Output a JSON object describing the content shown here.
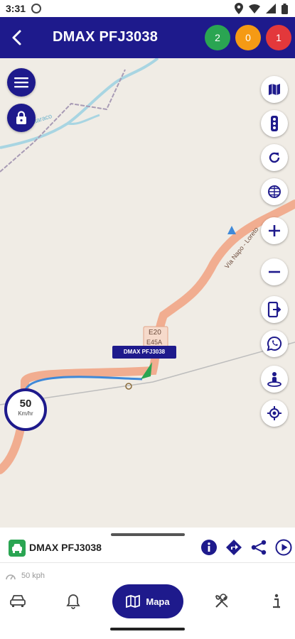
{
  "status_bar": {
    "time": "3:31"
  },
  "header": {
    "title": "DMAX PFJ3038"
  },
  "badges": {
    "green": "2",
    "orange": "0",
    "red": "1"
  },
  "colors": {
    "primary": "#1e1a8c",
    "badge_green": "#2aa552",
    "badge_orange": "#f59a14",
    "badge_red": "#e3383b",
    "route_blue": "#3f89d8",
    "road_highway": "#f1ad90",
    "map_background": "#f0ece5"
  },
  "map": {
    "vehicle_label": "DMAX PFJ3038",
    "road_labels": {
      "river": "Río Huataraco",
      "via": "Vía Napo - Loreto",
      "side_road": "",
      "route_code_1": "E20",
      "route_code_2": "E45A"
    },
    "speed_gauge": {
      "value": "50",
      "unit": "Km/hr"
    },
    "left_buttons": [
      "menu-icon",
      "lock-icon"
    ],
    "right_buttons": [
      "map-layers-icon",
      "traffic-light-icon",
      "refresh-icon",
      "globe-grid-icon",
      "zoom-in-icon",
      "zoom-out-icon",
      "share-screen-icon",
      "whatsapp-icon",
      "street-view-icon",
      "my-location-icon"
    ]
  },
  "bottom_sheet": {
    "vehicle_name": "DMAX PFJ3038",
    "speed_text": "50 kph",
    "actions": [
      "info-icon",
      "directions-icon",
      "share-icon",
      "play-icon"
    ]
  },
  "bottom_nav": {
    "items": [
      "car-icon",
      "bell-icon",
      "map-icon",
      "tools-icon",
      "info-icon"
    ],
    "active_label": "Mapa"
  }
}
